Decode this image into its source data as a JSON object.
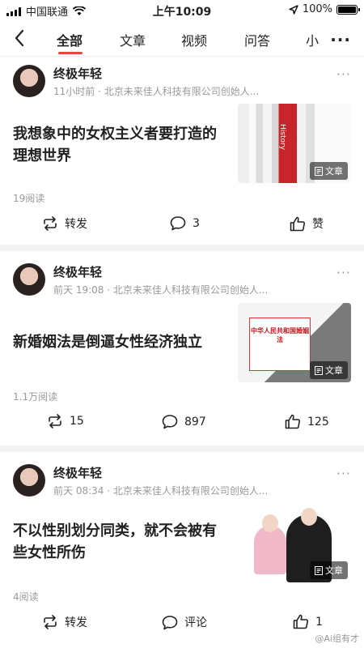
{
  "status_bar": {
    "carrier": "中国联通",
    "time": "上午10:09",
    "battery": "100%",
    "battery_level": 1.0
  },
  "nav": {
    "tabs": [
      "全部",
      "文章",
      "视频",
      "问答",
      "小"
    ],
    "active_tab": "全部"
  },
  "posts": [
    {
      "author": "终极年轻",
      "meta": "11小时前 · 北京未来佳人科技有限公司创始人...",
      "title": "我想象中的女权主义者要打造的理想世界",
      "thumb_text": "History",
      "badge": "文章",
      "reads": "19阅读",
      "repost": "转发",
      "comments": "3",
      "likes": "赞"
    },
    {
      "author": "终极年轻",
      "meta": "前天 19:08 · 北京未来佳人科技有限公司创始人...",
      "title": "新婚姻法是倒逼女性经济独立",
      "thumb_text": "中华人民共和国婚姻法",
      "badge": "文章",
      "reads": "1.1万阅读",
      "repost": "15",
      "comments": "897",
      "likes": "125"
    },
    {
      "author": "终极年轻",
      "meta": "前天 08:34 · 北京未来佳人科技有限公司创始人...",
      "title": "不以性别划分同类，就不会被有些女性所伤",
      "thumb_text": "",
      "badge": "文章",
      "reads": "4阅读",
      "repost": "转发",
      "comments": "评论",
      "likes": "1"
    }
  ],
  "watermark": "@Ai组有才"
}
